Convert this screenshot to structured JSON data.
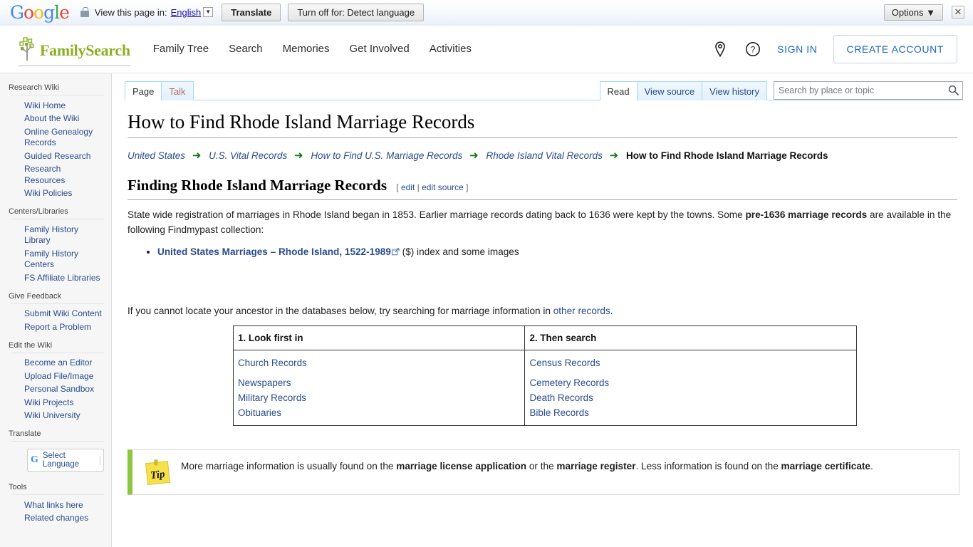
{
  "translate_bar": {
    "logo": "Google",
    "lock_icon": "lock-icon",
    "label": "View this page in:",
    "language": "English",
    "translate_button": "Translate",
    "turn_off_button": "Turn off for: Detect language",
    "options_button": "Options ▼",
    "close_icon": "✕"
  },
  "header": {
    "brand": "FamilySearch",
    "nav": [
      {
        "label": "Family Tree"
      },
      {
        "label": "Search"
      },
      {
        "label": "Memories"
      },
      {
        "label": "Get Involved"
      },
      {
        "label": "Activities"
      }
    ],
    "location_icon": "map-pin-icon",
    "help_icon": "question-circle-icon",
    "sign_in": "SIGN IN",
    "create_account": "CREATE ACCOUNT"
  },
  "sidebar": {
    "sections": [
      {
        "heading": "Research Wiki",
        "items": [
          "Wiki Home",
          "About the Wiki",
          "Online Genealogy Records",
          "Guided Research",
          "Research Resources",
          "Wiki Policies"
        ]
      },
      {
        "heading": "Centers/Libraries",
        "items": [
          "Family History Library",
          "Family History Centers",
          "FS Affiliate Libraries"
        ]
      },
      {
        "heading": "Give Feedback",
        "items": [
          "Submit Wiki Content",
          "Report a Problem"
        ]
      },
      {
        "heading": "Edit the Wiki",
        "items": [
          "Become an Editor",
          "Upload File/Image",
          "Personal Sandbox",
          "Wiki Projects",
          "Wiki University"
        ]
      },
      {
        "heading": "Translate",
        "items": []
      },
      {
        "heading": "Tools",
        "items": [
          "What links here",
          "Related changes"
        ]
      }
    ],
    "language_widget": {
      "icon": "google-g-icon",
      "label": "Select Language"
    }
  },
  "tabs": {
    "left": [
      {
        "label": "Page",
        "selected": true
      },
      {
        "label": "Talk",
        "selected": false
      }
    ],
    "right": [
      {
        "label": "Read",
        "selected": true
      },
      {
        "label": "View source",
        "selected": false
      },
      {
        "label": "View history",
        "selected": false
      }
    ]
  },
  "search": {
    "placeholder": "Search by place or topic",
    "value": "",
    "icon": "search-icon"
  },
  "article": {
    "title": "How to Find Rhode Island Marriage Records",
    "breadcrumb": [
      "United States",
      "U.S. Vital Records",
      "How to Find U.S. Marriage Records",
      "Rhode Island Vital Records"
    ],
    "breadcrumb_current": "How to Find Rhode Island Marriage Records",
    "breadcrumb_arrow": "➜",
    "section_heading": "Finding Rhode Island Marriage Records",
    "edit_links": {
      "open": "[",
      "edit": "edit",
      "sep": "|",
      "edit_source": "edit source",
      "close": "]"
    },
    "intro_part1": "State wide registration of marriages in Rhode Island began in 1853. Earlier marriage records dating back to 1636 were kept by the towns. Some ",
    "intro_bold": "pre-1636 marriage records",
    "intro_part2": " are available in the following Findmypast collection:",
    "bullet_link": "United States Marriages – Rhode Island, 1522-1989",
    "bullet_suffix": " ($) index and some images",
    "external_icon": "external-link-icon",
    "locate_part1": "If you cannot locate your ancestor in the databases below, try searching for marriage information in ",
    "locate_link": "other records",
    "locate_part2": ".",
    "table": {
      "headers": [
        "1. Look first in",
        "2. Then search"
      ],
      "col1": [
        "Church Records",
        "Newspapers",
        "Military Records",
        "Obituaries"
      ],
      "col2": [
        "Census Records",
        "Cemetery Records",
        "Death Records",
        "Bible Records"
      ]
    },
    "tip": {
      "icon": "tip-sticky-note-icon",
      "icon_label": "Tip",
      "part1": "More marriage information is usually found on the ",
      "bold1": "marriage license application",
      "part2": " or the ",
      "bold2": "marriage register",
      "part3": ". Less information is found on the ",
      "bold3": "marriage certificate",
      "part4": "."
    }
  },
  "colors": {
    "brand_green": "#8ab024",
    "link_blue": "#2a4b8d",
    "tip_green": "#8cc63e",
    "arrow_green": "#147814"
  }
}
